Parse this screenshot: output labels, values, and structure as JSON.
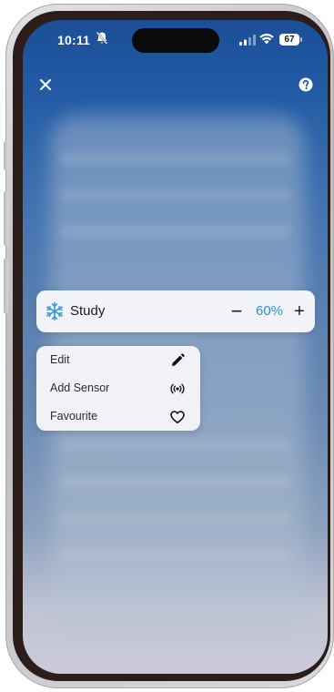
{
  "status_bar": {
    "time": "10:11",
    "battery": "67"
  },
  "room": {
    "name": "Study",
    "percent": "60%",
    "minus_label": "−",
    "plus_label": "+",
    "accent_color": "#2f8fd4"
  },
  "menu": {
    "items": [
      {
        "label": "Edit",
        "icon": "pencil-icon"
      },
      {
        "label": "Add Sensor",
        "icon": "sensor-icon"
      },
      {
        "label": "Favourite",
        "icon": "heart-icon"
      }
    ]
  }
}
